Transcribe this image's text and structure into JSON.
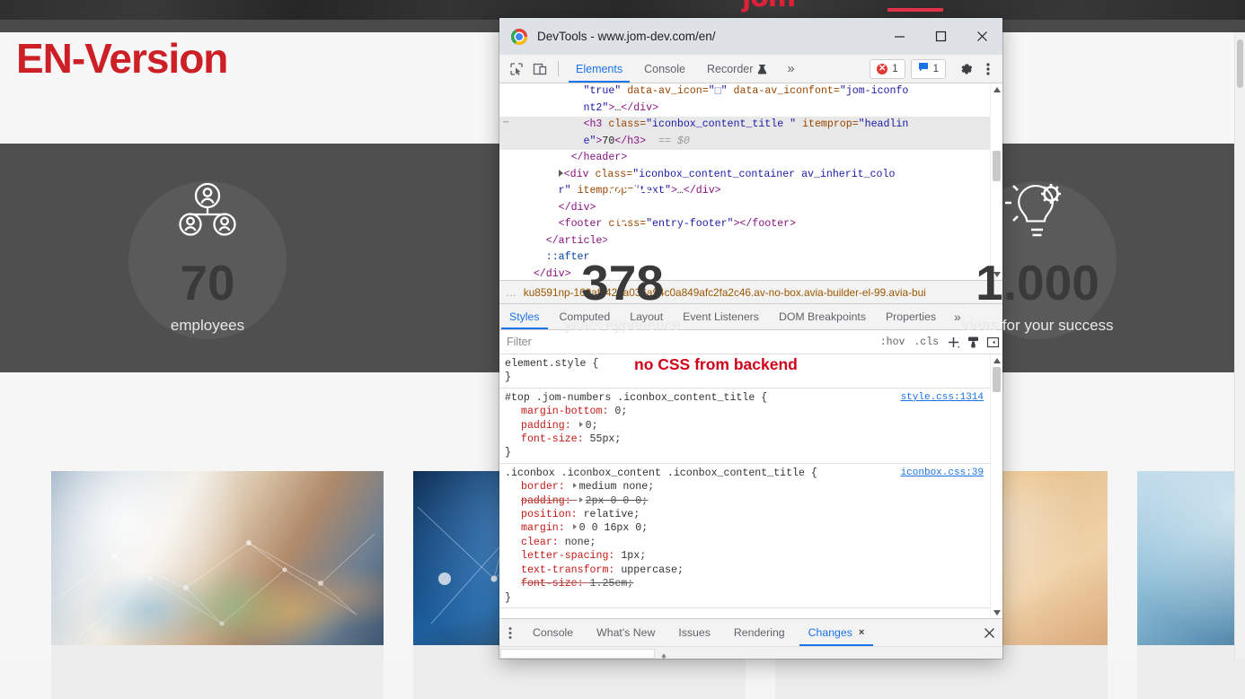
{
  "website": {
    "logo_text": "jom",
    "headline": "EN-Version",
    "stats": [
      {
        "icon": "people-network-icon",
        "value": "70",
        "caption": "employees"
      },
      {
        "icon": "support-agent-icon",
        "value": "378",
        "caption": "years eyperience"
      },
      {
        "icon": "idea-bulb-gear-icon",
        "value": "1.000",
        "caption": "ideas for your success"
      }
    ],
    "gallery": [
      {
        "name": "team-meeting-photo"
      },
      {
        "name": "night-city-network-photo"
      },
      {
        "name": "desk-top-view-photo"
      },
      {
        "name": "hand-pen-chart-photo"
      }
    ]
  },
  "devtools": {
    "window_title": "DevTools - www.jom-dev.com/en/",
    "window_buttons": {
      "minimize": "minimize-button",
      "maximize": "maximize-button",
      "close": "close-button"
    },
    "toolbar": {
      "inspect_icon": "inspect-element-icon",
      "device_icon": "device-toolbar-icon",
      "tabs": [
        {
          "label": "Elements",
          "active": true
        },
        {
          "label": "Console",
          "active": false
        },
        {
          "label": "Recorder",
          "active": false,
          "badge_icon": "flask-icon"
        }
      ],
      "more_tabs": "»",
      "error_count": "1",
      "message_count": "1",
      "settings_icon": "gear-icon",
      "menu_icon": "kebab-menu-icon"
    },
    "dom": [
      {
        "indent": 6,
        "marker": "none",
        "selected": false,
        "parts": [
          {
            "t": "av",
            "s": "\"true\""
          },
          {
            "t": "sp",
            "s": " "
          },
          {
            "t": "at",
            "s": "data-av_icon="
          },
          {
            "t": "av",
            "s": "\"⬚\""
          },
          {
            "t": "sp",
            "s": " "
          },
          {
            "t": "at",
            "s": "data-av_iconfont="
          },
          {
            "t": "av",
            "s": "\"jom-iconfo"
          }
        ]
      },
      {
        "indent": 6,
        "marker": "none",
        "selected": false,
        "parts": [
          {
            "t": "av",
            "s": "nt2\""
          },
          {
            "t": "tg",
            "s": ">"
          },
          {
            "t": "tx",
            "s": "…"
          },
          {
            "t": "tg",
            "s": "</div>"
          }
        ]
      },
      {
        "indent": 6,
        "marker": "dots",
        "selected": true,
        "parts": [
          {
            "t": "tg",
            "s": "<h3 "
          },
          {
            "t": "at",
            "s": "class="
          },
          {
            "t": "av",
            "s": "\"iconbox_content_title \""
          },
          {
            "t": "sp",
            "s": " "
          },
          {
            "t": "at",
            "s": "itemprop="
          },
          {
            "t": "av",
            "s": "\"headlin"
          }
        ]
      },
      {
        "indent": 6,
        "marker": "none",
        "selected": true,
        "parts": [
          {
            "t": "av",
            "s": "e\""
          },
          {
            "t": "tg",
            "s": ">"
          },
          {
            "t": "tx",
            "s": "70"
          },
          {
            "t": "tg",
            "s": "</h3>"
          },
          {
            "t": "gr",
            "s": "  == $0"
          }
        ]
      },
      {
        "indent": 5,
        "marker": "none",
        "selected": false,
        "parts": [
          {
            "t": "tg",
            "s": "</header>"
          }
        ]
      },
      {
        "indent": 4,
        "marker": "triangle",
        "selected": false,
        "parts": [
          {
            "t": "tg",
            "s": "<div "
          },
          {
            "t": "at",
            "s": "class="
          },
          {
            "t": "av",
            "s": "\"iconbox_content_container av_inherit_colo"
          }
        ]
      },
      {
        "indent": 4,
        "marker": "none",
        "selected": false,
        "parts": [
          {
            "t": "av",
            "s": "r\""
          },
          {
            "t": "sp",
            "s": " "
          },
          {
            "t": "at",
            "s": "itemprop="
          },
          {
            "t": "av",
            "s": "\"text\""
          },
          {
            "t": "tg",
            "s": ">"
          },
          {
            "t": "tx",
            "s": "…"
          },
          {
            "t": "tg",
            "s": "</div>"
          }
        ]
      },
      {
        "indent": 4,
        "marker": "none",
        "selected": false,
        "parts": [
          {
            "t": "tg",
            "s": "</div>"
          }
        ]
      },
      {
        "indent": 4,
        "marker": "none",
        "selected": false,
        "parts": [
          {
            "t": "tg",
            "s": "<footer "
          },
          {
            "t": "at",
            "s": "class="
          },
          {
            "t": "av",
            "s": "\"entry-footer\""
          },
          {
            "t": "tg",
            "s": "></footer>"
          }
        ]
      },
      {
        "indent": 3,
        "marker": "none",
        "selected": false,
        "parts": [
          {
            "t": "tg",
            "s": "</article>"
          }
        ]
      },
      {
        "indent": 3,
        "marker": "none",
        "selected": false,
        "parts": [
          {
            "t": "ps",
            "s": "::after"
          }
        ]
      },
      {
        "indent": 2,
        "marker": "none",
        "selected": false,
        "parts": [
          {
            "t": "tg",
            "s": "</div>"
          }
        ]
      }
    ],
    "breadcrumb": {
      "leading_ellipsis": "…",
      "path": "ku8591np-160afc42da036a94c0a849afc2fa2c46.av-no-box.avia-builder-el-99.avia-bui",
      "trailing_ellipsis": "…"
    },
    "styles_tabs": [
      {
        "label": "Styles",
        "active": true
      },
      {
        "label": "Computed",
        "active": false
      },
      {
        "label": "Layout",
        "active": false
      },
      {
        "label": "Event Listeners",
        "active": false
      },
      {
        "label": "DOM Breakpoints",
        "active": false
      },
      {
        "label": "Properties",
        "active": false
      },
      {
        "label": "»",
        "active": false
      }
    ],
    "filter_bar": {
      "placeholder": "Filter",
      "value": "",
      "hov": ":hov",
      "cls": ".cls",
      "new_rule_icon": "plus-icon",
      "element_state_icon": "style-preview-icon",
      "sidebar_toggle_icon": "panel-toggle-icon"
    },
    "annotation": {
      "text": "no CSS from backend",
      "color": "#d0021b"
    },
    "css_rules": [
      {
        "selector": "element.style {",
        "source": "",
        "declarations": [],
        "close": "}"
      },
      {
        "selector": "#top .jom-numbers .iconbox_content_title {",
        "source": "style.css:1314",
        "declarations": [
          {
            "prop": "margin-bottom",
            "value": "0;",
            "expandable": false,
            "disabled": false
          },
          {
            "prop": "padding",
            "value": "0;",
            "expandable": true,
            "disabled": false
          },
          {
            "prop": "font-size",
            "value": "55px;",
            "expandable": false,
            "disabled": false
          }
        ],
        "close": "}"
      },
      {
        "selector": ".iconbox .iconbox_content .iconbox_content_title {",
        "source": "iconbox.css:39",
        "declarations": [
          {
            "prop": "border",
            "value": "medium none;",
            "expandable": true,
            "disabled": false
          },
          {
            "prop": "padding",
            "value": "2px 0 0 0;",
            "expandable": true,
            "disabled": true
          },
          {
            "prop": "position",
            "value": "relative;",
            "expandable": false,
            "disabled": false
          },
          {
            "prop": "margin",
            "value": "0 0 16px 0;",
            "expandable": true,
            "disabled": false
          },
          {
            "prop": "clear",
            "value": "none;",
            "expandable": false,
            "disabled": false
          },
          {
            "prop": "letter-spacing",
            "value": "1px;",
            "expandable": false,
            "disabled": false
          },
          {
            "prop": "text-transform",
            "value": "uppercase;",
            "expandable": false,
            "disabled": false
          },
          {
            "prop": "font-size",
            "value": "1.25em;",
            "expandable": false,
            "disabled": true
          }
        ],
        "close": "}"
      }
    ],
    "drawer": {
      "kebab_icon": "kebab-menu-icon",
      "tabs": [
        {
          "label": "Console",
          "active": false,
          "closable": false
        },
        {
          "label": "What's New",
          "active": false,
          "closable": false
        },
        {
          "label": "Issues",
          "active": false,
          "closable": false
        },
        {
          "label": "Rendering",
          "active": false,
          "closable": false
        },
        {
          "label": "Changes",
          "active": true,
          "closable": true,
          "close_glyph": "×"
        }
      ],
      "close_icon": "close-drawer-icon"
    }
  }
}
